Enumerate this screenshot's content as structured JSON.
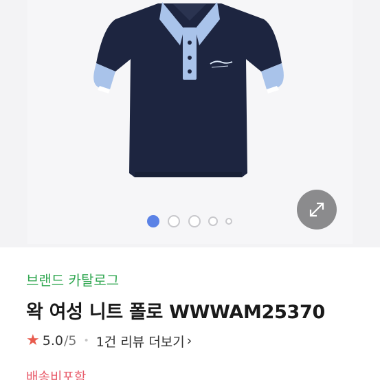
{
  "product": {
    "brand_catalog": "브랜드 카탈로그",
    "title": "왁 여성 니트 폴로 WWWAM25370",
    "image_icon": "knit-polo-shirt-navy-light-blue-trim"
  },
  "gallery": {
    "total_images": 5,
    "active_index": 0,
    "expand_icon": "expand-arrows-icon"
  },
  "rating": {
    "score": "5.0",
    "slash": "/",
    "max": "5",
    "separator": "•",
    "review_link": "1건 리뷰 더보기",
    "chevron": "›"
  },
  "shipping": {
    "label": "배송비포함"
  },
  "colors": {
    "brand_green": "#33a853",
    "star_red": "#e85b4d",
    "shipping_red": "#e85b6a",
    "dot_active": "#5b82e6",
    "shirt_navy": "#1d2540",
    "trim_light_blue": "#a9c3ea"
  }
}
